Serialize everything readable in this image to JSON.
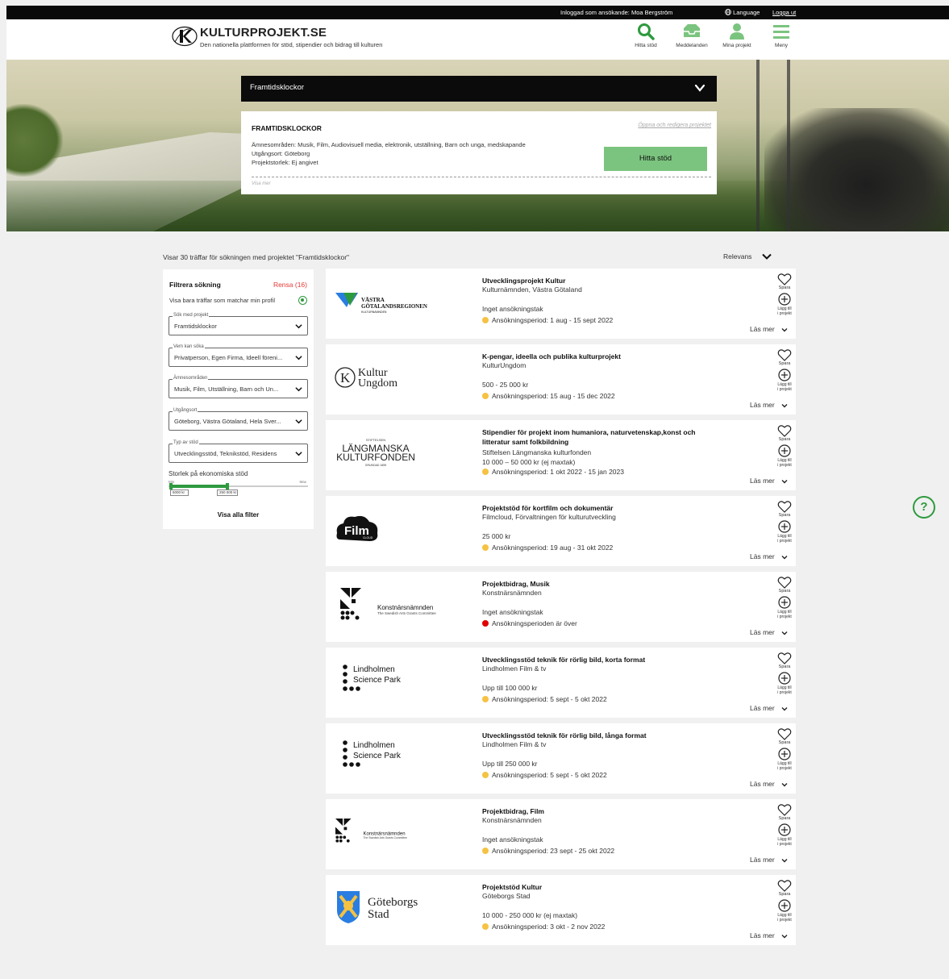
{
  "topbar": {
    "user": "Inloggad som ansökande: Moa Bergström",
    "language": "Language",
    "logout": "Logga ut"
  },
  "header": {
    "title": "KULTURPROJEKT.SE",
    "subtitle": "Den nationella plattformen för stöd, stipendier och bidrag till kulturen",
    "nav": [
      {
        "label": "Hitta stöd",
        "icon": "search-icon"
      },
      {
        "label": "Meddelanden",
        "icon": "inbox-icon"
      },
      {
        "label": "Mina projekt",
        "icon": "user-icon"
      },
      {
        "label": "Meny",
        "icon": "menu-icon"
      }
    ]
  },
  "project": {
    "selected": "Framtidsklockor",
    "title": "FRAMTIDSKLOCKOR",
    "edit_link": "Öppna och redigera projektet",
    "areas": "Ämnesområden: Musik, Film, Audiovisuell media, elektronik, utställning, Barn och unga, medskapande",
    "location": "Utgångsort: Göteborg",
    "size": "Projektstorlek: Ej angivet",
    "show_more": "Visa mer",
    "find_button": "Hitta stöd"
  },
  "results": {
    "count_text": "Visar 30 träffar för sökningen med projektet \"Framtidsklockor\"",
    "sort_label": "Relevans"
  },
  "filter": {
    "title": "Filtrera sökning",
    "clear": "Rensa (16)",
    "match_profile": "Visa bara träffar som matchar min profil",
    "selects": [
      {
        "legend": "Sök med projekt",
        "value": "Framtidsklockor"
      },
      {
        "legend": "Vem kan söka",
        "value": "Privatperson, Egen Firma, Ideell föreni..."
      },
      {
        "legend": "Ämnesområden",
        "value": "Musik, Film, Utställning, Barn och Un..."
      },
      {
        "legend": "Utgångsort",
        "value": "Göteborg, Västra Götaland, Hela Sver..."
      },
      {
        "legend": "Typ av stöd",
        "value": "Utvecklingsstöd, Teknikstöd, Residens"
      }
    ],
    "size_label": "Storlek på ekonomiska stöd",
    "slider_min_label": "Min",
    "slider_max_label": "Max",
    "slider_min_value": "5000 kr",
    "slider_max_value": "250 000 kr",
    "slider_range": [
      0.02,
      0.42
    ],
    "show_all": "Visa alla filter"
  },
  "card_labels": {
    "save": "Spara",
    "add_line1": "Lägg till",
    "add_line2": "i projekt",
    "read_more": "Läs mer"
  },
  "cards": [
    {
      "logo": "vastra-gotalandsregionen-logo",
      "logo_text": "VÄSTRA GÖTALANDSREGIONEN",
      "logo_sub": "KULTURNÄMNDEN",
      "title": "Utvecklingsprojekt Kultur",
      "org": "Kulturnämnden, Västra Götaland",
      "amount": "Inget ansökningstak",
      "period": "Ansökningsperiod: 1 aug - 15 sept 2022",
      "status": "open"
    },
    {
      "logo": "kultur-ungdom-logo",
      "logo_text": "Kultur",
      "logo_sub": "Ungdom",
      "title": "K-pengar, ideella och publika kulturprojekt",
      "org": "KulturUngdom",
      "amount": "500 - 25 000 kr",
      "period": "Ansökningsperiod: 15 aug - 15 dec 2022",
      "status": "open"
    },
    {
      "logo": "langmanska-logo",
      "logo_text": "LÄNGMANSKA",
      "logo_sub": "KULTURFONDEN",
      "logo_top": "STIFTELSEN",
      "logo_bottom": "GRUNDAD 1859",
      "title": "Stipendier för projekt inom humaniora, naturvetenskap,konst och litteratur samt folkbildning",
      "org": "Stiftelsen Längmanska kulturfonden",
      "amount": "10 000 – 50 000 kr (ej maxtak)",
      "period": "Ansökningsperiod: 1 okt 2022 - 15 jan 2023",
      "status": "open"
    },
    {
      "logo": "filmcloud-logo",
      "logo_text": "Film",
      "logo_sub": "CLOUD",
      "title": "Projektstöd för kortfilm och dokumentär",
      "org": "Filmcloud, Förvaltningen för kulturutveckling",
      "amount": "25 000 kr",
      "period": "Ansökningsperiod: 19 aug - 31 okt 2022",
      "status": "open"
    },
    {
      "logo": "konstnarsnamnden-logo",
      "logo_text": "Konstnärsnämnden",
      "logo_sub": "The Swedish Arts Grants Committee",
      "title": "Projektbidrag, Musik",
      "org": "Konstnärsnämnden",
      "amount": "Inget ansökningstak",
      "period": "Ansökningsperioden är över",
      "status": "closed"
    },
    {
      "logo": "lindholmen-logo",
      "logo_text": "Lindholmen",
      "logo_sub": "Science Park",
      "title": "Utvecklingsstöd teknik för rörlig bild, korta format",
      "org": "Lindholmen Film & tv",
      "amount": "Upp till 100 000 kr",
      "period": "Ansökningsperiod: 5 sept - 5 okt 2022",
      "status": "open"
    },
    {
      "logo": "lindholmen-logo",
      "logo_text": "Lindholmen",
      "logo_sub": "Science Park",
      "title": "Utvecklingsstöd teknik för rörlig bild, långa format",
      "org": "Lindholmen Film & tv",
      "amount": "Upp till 250 000 kr",
      "period": "Ansökningsperiod: 5 sept - 5 okt 2022",
      "status": "open"
    },
    {
      "logo": "konstnarsnamnden-logo",
      "logo_text": "Konstnärsnämnden",
      "logo_sub": "The Swedish Arts Grants Committee",
      "title": "Projektbidrag, Film",
      "org": "Konstnärsnämnden",
      "amount": "Inget ansökningstak",
      "period": "Ansökningsperiod: 23 sept - 25 okt 2022",
      "status": "open"
    },
    {
      "logo": "goteborgs-stad-logo",
      "logo_text": "Göteborgs",
      "logo_sub": "Stad",
      "title": "Projektstöd Kultur",
      "org": "Göteborgs Stad",
      "amount": "10 000 - 250 000 kr (ej maxtak)",
      "period": "Ansökningsperiod: 3 okt - 2 nov 2022",
      "status": "open"
    }
  ],
  "colors": {
    "accent": "#2e9a3e",
    "open": "#f5c242",
    "closed": "#e00000",
    "button": "#7bc47f",
    "clear": "#e53935"
  },
  "help": "?"
}
